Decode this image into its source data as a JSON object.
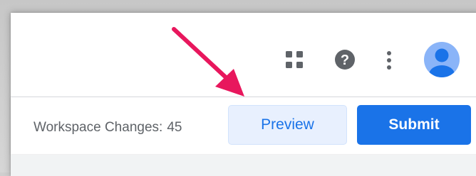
{
  "header": {
    "icons": {
      "apps": "apps-grid-icon",
      "help": "help-icon",
      "more": "more-vertical-icon",
      "avatar": "account-avatar"
    }
  },
  "workspace": {
    "changes_label": "Workspace Changes:",
    "changes_count": "45"
  },
  "actions": {
    "preview_label": "Preview",
    "submit_label": "Submit"
  },
  "colors": {
    "accent": "#1a73e8",
    "preview_bg": "#e8f0fe",
    "annotation_arrow": "#e8175d",
    "avatar": "#8ab4f8"
  }
}
